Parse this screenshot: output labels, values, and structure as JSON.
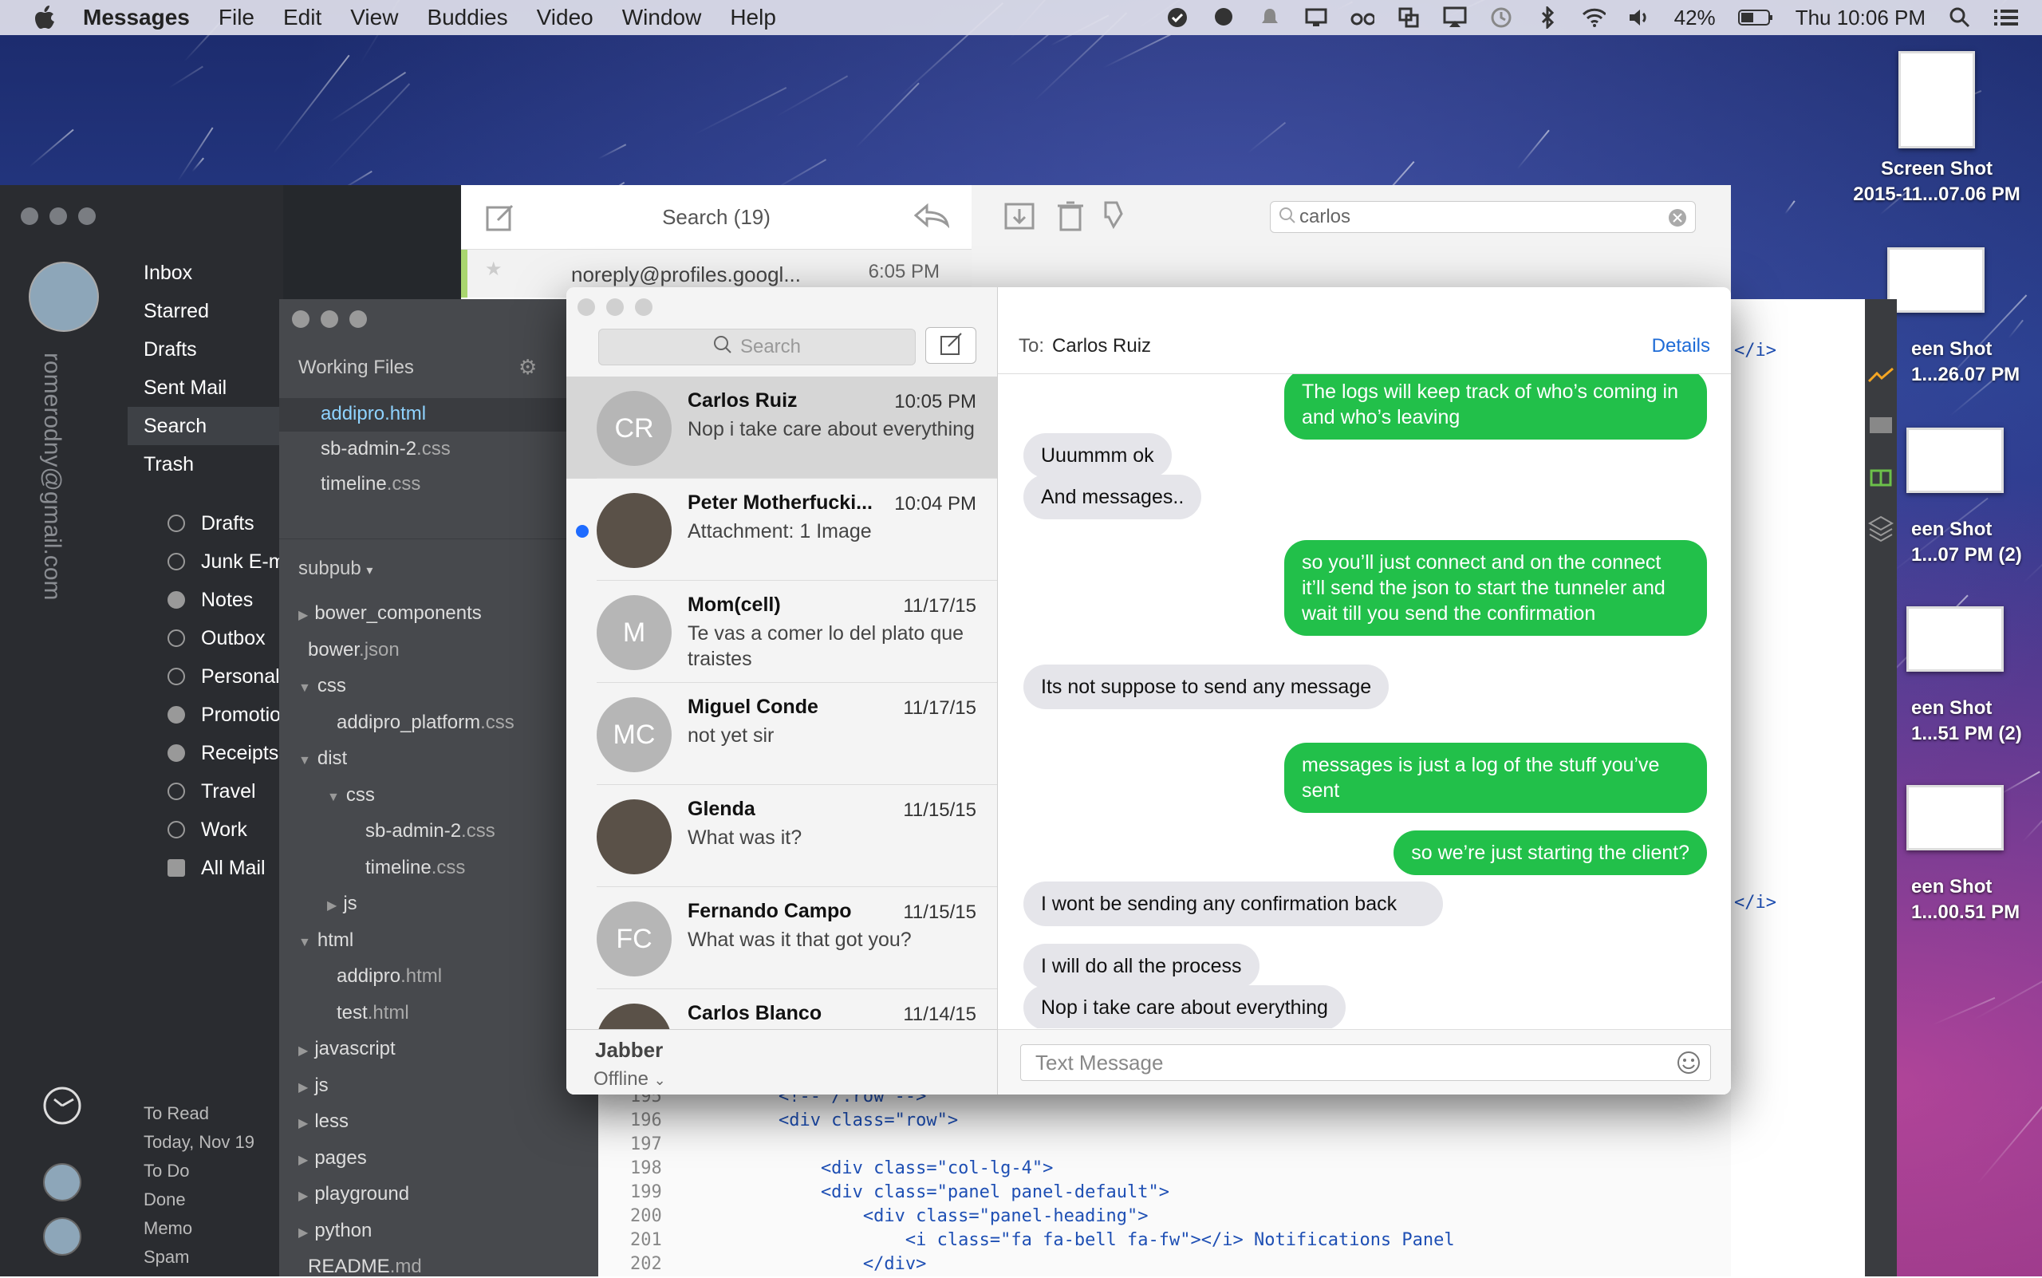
{
  "menubar": {
    "apple_icon": "apple-icon",
    "app": "Messages",
    "items": [
      "File",
      "Edit",
      "View",
      "Buddies",
      "Video",
      "Window",
      "Help"
    ],
    "battery": "42%",
    "clock": "Thu 10:06 PM"
  },
  "desktop_files": [
    {
      "line1": "Screen Shot",
      "line2": "2015-11...07.06 PM"
    },
    {
      "line1": "een Shot",
      "line2": "1...26.07 PM"
    },
    {
      "line1": "een Shot",
      "line2": "1...07 PM (2)"
    },
    {
      "line1": "een Shot",
      "line2": "1...51 PM (2)"
    },
    {
      "line1": "een Shot",
      "line2": "1...00.51 PM"
    }
  ],
  "mail": {
    "account_email": "romerodny@gmail.com",
    "nav": [
      "Inbox",
      "Starred",
      "Drafts",
      "Sent Mail",
      "Search",
      "Trash"
    ],
    "labels": [
      "Drafts",
      "Junk E-m",
      "Notes",
      "Outbox",
      "Personal",
      "Promotio",
      "Receipts",
      "Travel",
      "Work",
      "All Mail"
    ],
    "bottom": [
      "To Read",
      "Today, Nov 19",
      "To Do",
      "Done",
      "Memo",
      "Spam"
    ],
    "list_title": "Search (19)",
    "first_sender": "noreply@profiles.googl...",
    "first_time": "6:05 PM",
    "search_value": "carlos"
  },
  "editor": {
    "working_files_title": "Working Files",
    "working_files": [
      {
        "name": "addipro",
        ".ext": ".html"
      },
      {
        "name": "sb-admin-2",
        ".ext": ".css"
      },
      {
        "name": "timeline",
        ".ext": ".css"
      }
    ],
    "project": "subpub",
    "tree": [
      {
        "t": "bower_components",
        "ext": "",
        "indent": 0,
        "arrow": "right"
      },
      {
        "t": "bower",
        "ext": ".json",
        "indent": 0,
        "arrow": ""
      },
      {
        "t": "css",
        "ext": "",
        "indent": 0,
        "arrow": "down"
      },
      {
        "t": "addipro_platform",
        "ext": ".css",
        "indent": 1,
        "arrow": ""
      },
      {
        "t": "dist",
        "ext": "",
        "indent": 0,
        "arrow": "down"
      },
      {
        "t": "css",
        "ext": "",
        "indent": 1,
        "arrow": "down"
      },
      {
        "t": "sb-admin-2",
        "ext": ".css",
        "indent": 2,
        "arrow": ""
      },
      {
        "t": "timeline",
        "ext": ".css",
        "indent": 2,
        "arrow": ""
      },
      {
        "t": "js",
        "ext": "",
        "indent": 1,
        "arrow": "right"
      },
      {
        "t": "html",
        "ext": "",
        "indent": 0,
        "arrow": "down"
      },
      {
        "t": "addipro",
        "ext": ".html",
        "indent": 1,
        "arrow": ""
      },
      {
        "t": "test",
        "ext": ".html",
        "indent": 1,
        "arrow": ""
      },
      {
        "t": "javascript",
        "ext": "",
        "indent": 0,
        "arrow": "right"
      },
      {
        "t": "js",
        "ext": "",
        "indent": 0,
        "arrow": "right"
      },
      {
        "t": "less",
        "ext": "",
        "indent": 0,
        "arrow": "right"
      },
      {
        "t": "pages",
        "ext": "",
        "indent": 0,
        "arrow": "right"
      },
      {
        "t": "playground",
        "ext": "",
        "indent": 0,
        "arrow": "right"
      },
      {
        "t": "python",
        "ext": "",
        "indent": 0,
        "arrow": "right"
      },
      {
        "t": "README",
        "ext": ".md",
        "indent": 0,
        "arrow": ""
      }
    ],
    "code": [
      {
        "ln": "195",
        "txt": "        <!-- /.row -->"
      },
      {
        "ln": "196",
        "txt": "        <div class=\"row\">"
      },
      {
        "ln": "197",
        "txt": ""
      },
      {
        "ln": "198",
        "txt": "            <div class=\"col-lg-4\">"
      },
      {
        "ln": "199",
        "txt": "            <div class=\"panel panel-default\">"
      },
      {
        "ln": "200",
        "txt": "                <div class=\"panel-heading\">"
      },
      {
        "ln": "201",
        "txt": "                    <i class=\"fa fa-bell fa-fw\"></i> Notifications Panel"
      },
      {
        "ln": "202",
        "txt": "                </div>"
      }
    ]
  },
  "messages": {
    "search_placeholder": "Search",
    "conversations": [
      {
        "initials": "CR",
        "name": "Carlos Ruiz",
        "time": "10:05 PM",
        "preview": "Nop i take care about everything",
        "selected": true,
        "unread": false,
        "photo": false
      },
      {
        "initials": "",
        "name": "Peter Motherfucki...",
        "time": "10:04 PM",
        "preview": "Attachment: 1 Image",
        "selected": false,
        "unread": true,
        "photo": true
      },
      {
        "initials": "M",
        "name": "Mom(cell)",
        "time": "11/17/15",
        "preview": "Te vas a comer lo del plato que traistes",
        "selected": false,
        "unread": false,
        "photo": false
      },
      {
        "initials": "MC",
        "name": "Miguel Conde",
        "time": "11/17/15",
        "preview": "not yet sir",
        "selected": false,
        "unread": false,
        "photo": false
      },
      {
        "initials": "",
        "name": "Glenda",
        "time": "11/15/15",
        "preview": "What was it?",
        "selected": false,
        "unread": false,
        "photo": true
      },
      {
        "initials": "FC",
        "name": "Fernando Campo",
        "time": "11/15/15",
        "preview": "What was it that got you?",
        "selected": false,
        "unread": false,
        "photo": false
      },
      {
        "initials": "",
        "name": "Carlos Blanco",
        "time": "11/14/15",
        "preview": "",
        "selected": false,
        "unread": false,
        "photo": true
      }
    ],
    "jabber_title": "Jabber",
    "jabber_status": "Offline",
    "to_label": "To:",
    "to_name": "Carlos Ruiz",
    "details": "Details",
    "input_placeholder": "Text Message",
    "bubbles": [
      {
        "dir": "out",
        "text": "The logs will keep track of who’s coming in and who’s leaving"
      },
      {
        "dir": "in",
        "text": "Uuummm ok"
      },
      {
        "dir": "in",
        "text": "And messages.."
      },
      {
        "dir": "out",
        "text": "so you’ll just connect and on the connect it’ll send the json to start the tunneler and wait till you send the confirmation"
      },
      {
        "dir": "in",
        "text": "Its not suppose to send any message"
      },
      {
        "dir": "out",
        "text": "messages is just a log of the stuff you’ve sent"
      },
      {
        "dir": "out",
        "text": "so we’re just starting the client?"
      },
      {
        "dir": "in",
        "text": "I wont be sending any confirmation back"
      },
      {
        "dir": "in",
        "text": "I will do all the process"
      },
      {
        "dir": "in",
        "text": "Nop i take care about everything"
      }
    ]
  },
  "colors": {
    "outgoing": "#22c04a",
    "incoming": "#e5e5ea",
    "link": "#1e6bd6"
  }
}
